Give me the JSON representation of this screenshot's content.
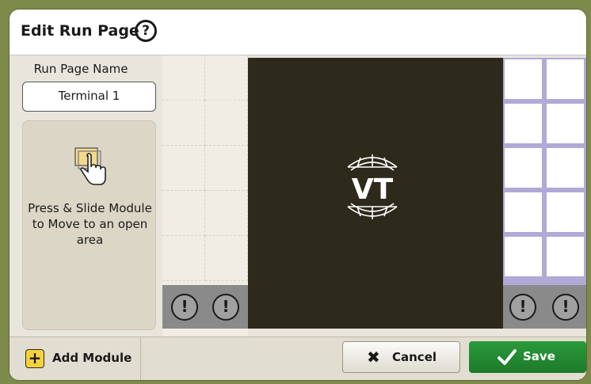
{
  "dialog": {
    "title": "Edit Run Page",
    "help_icon": "question-circle-icon"
  },
  "run_page_name": {
    "label": "Run Page Name",
    "value": "Terminal 1"
  },
  "hint": {
    "icon": "press-slide-hand-icon",
    "text": "Press & Slide Module to Move to an open area"
  },
  "grid": {
    "alert_icon": "exclamation-circle-icon",
    "module_logo": "VT",
    "module_logo_icon": "vt-globe-logo-icon"
  },
  "footer": {
    "add_module_label": "Add Module",
    "add_icon": "plus-icon",
    "cancel_label": "Cancel",
    "cancel_icon": "x-icon",
    "save_label": "Save",
    "save_icon": "checkmark-icon"
  },
  "colors": {
    "background": "#7e8a4a",
    "module_bg": "#2d2a1b",
    "save_green": "#1d7a2a",
    "add_yellow": "#f3d23b",
    "slot_border": "#b1a9d6"
  }
}
